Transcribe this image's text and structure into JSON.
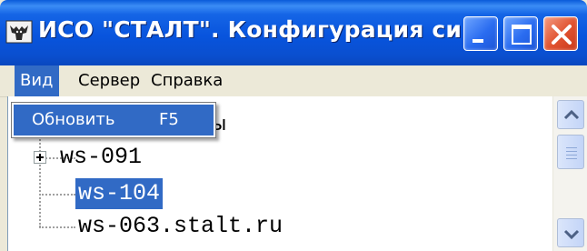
{
  "window": {
    "title": "ИСО \"СТАЛТ\". Конфигурация си...",
    "app_icon": "moose-app-icon",
    "buttons": [
      "minimize",
      "maximize",
      "close"
    ]
  },
  "menu": {
    "items": [
      {
        "label": "Вид",
        "active": true
      },
      {
        "label": "Сервер",
        "active": false
      },
      {
        "label": "Справка",
        "active": false
      }
    ],
    "dropdown": {
      "items": [
        {
          "label": "Обновить",
          "shortcut": "F5",
          "highlighted": true
        }
      ]
    }
  },
  "tree": {
    "partial_root_label": "ы",
    "nodes": [
      {
        "label": "ws-091",
        "expandable": true,
        "selected": false
      },
      {
        "label": "ws-104",
        "expandable": false,
        "selected": true
      },
      {
        "label": "ws-063.stalt.ru",
        "expandable": false,
        "selected": false
      }
    ]
  },
  "colors": {
    "titlebar": "#0a5bd9",
    "selection": "#316ac5",
    "window_face": "#ece9d8",
    "close_button": "#e0512f"
  }
}
